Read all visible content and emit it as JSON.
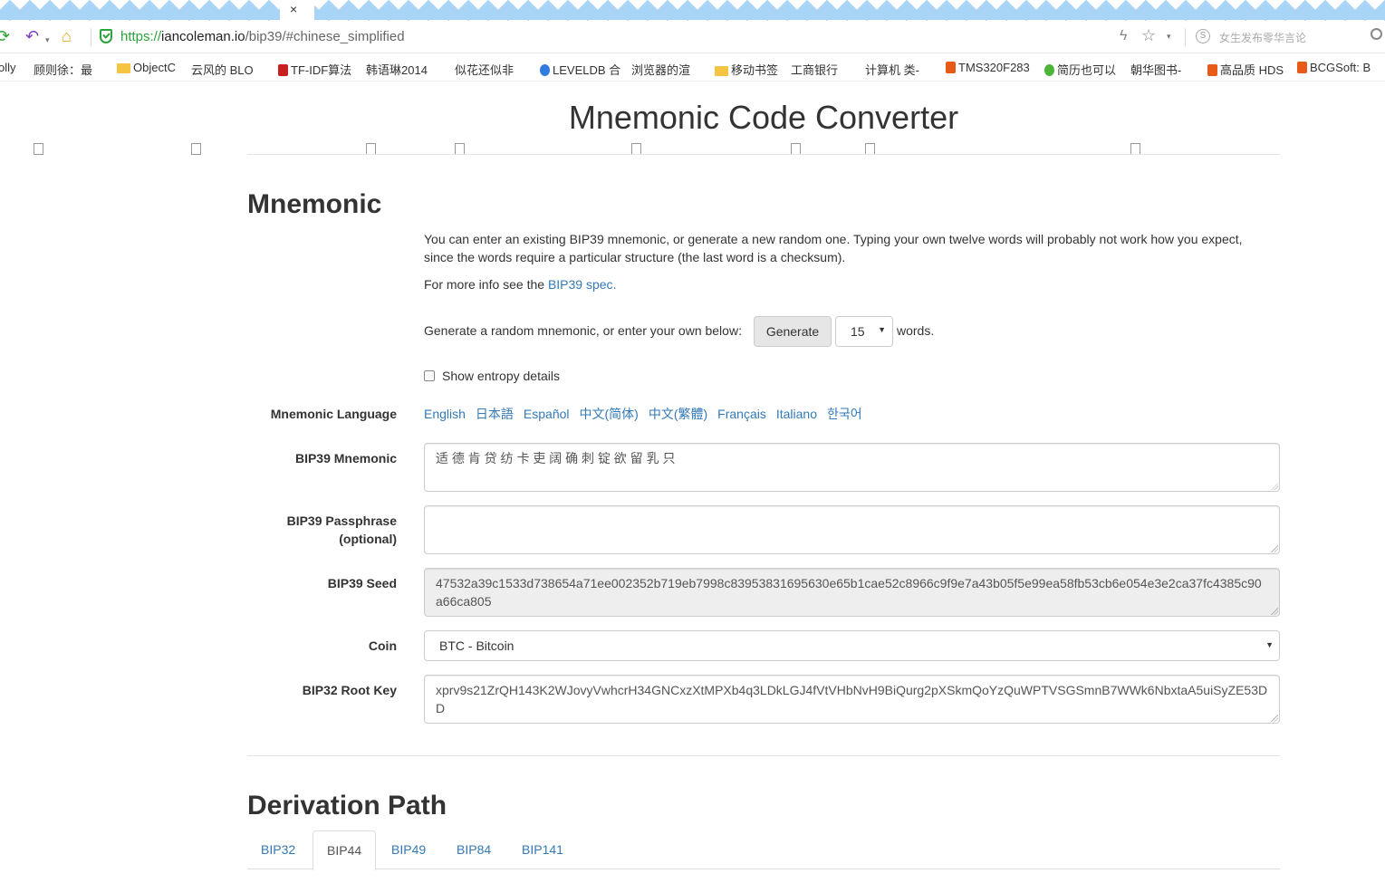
{
  "browser": {
    "tab_close": "×",
    "url": {
      "scheme": "https://",
      "host": "iancoleman.io",
      "path": "/bip39/#chinese_simplified"
    },
    "search_placeholder": "女生发布零华言论",
    "bookmarks": [
      {
        "label": "olly",
        "icon": "none"
      },
      {
        "label": "顾则徐：最",
        "icon": "page"
      },
      {
        "label": "ObjectC",
        "icon": "folder"
      },
      {
        "label": "云风的 BLO",
        "icon": "page"
      },
      {
        "label": "TF-IDF算法",
        "icon": "red"
      },
      {
        "label": "韩语琳2014",
        "icon": "page"
      },
      {
        "label": "似花还似非",
        "icon": "page"
      },
      {
        "label": "LEVELDB 合",
        "icon": "blue"
      },
      {
        "label": "浏览器的渲",
        "icon": "page"
      },
      {
        "label": "移动书签",
        "icon": "folder"
      },
      {
        "label": "工商银行",
        "icon": "page"
      },
      {
        "label": "计算机 类-",
        "icon": "page"
      },
      {
        "label": "TMS320F283",
        "icon": "orange"
      },
      {
        "label": "简历也可以",
        "icon": "green"
      },
      {
        "label": "朝华图书-",
        "icon": "page"
      },
      {
        "label": "高品质 HDS",
        "icon": "orange"
      },
      {
        "label": "BCGSoft: B",
        "icon": "orange"
      }
    ]
  },
  "page": {
    "title": "Mnemonic Code Converter",
    "mnemonic_heading": "Mnemonic",
    "intro": "You can enter an existing BIP39 mnemonic, or generate a new random one. Typing your own twelve words will probably not work how you expect, since the words require a particular structure (the last word is a checksum).",
    "more_info_prefix": "For more info see the ",
    "more_info_link": "BIP39 spec",
    "more_info_suffix": ".",
    "generate_prompt": "Generate a random mnemonic, or enter your own below:",
    "generate_button": "Generate",
    "word_count": "15",
    "words_suffix": "words.",
    "show_entropy": "Show entropy details",
    "language_label": "Mnemonic Language",
    "languages": [
      "English",
      "日本語",
      "Español",
      "中文(简体)",
      "中文(繁體)",
      "Français",
      "Italiano",
      "한국어"
    ],
    "bip39_mnemonic_label": "BIP39 Mnemonic",
    "bip39_mnemonic_value": "适 德 肯 贷 纺 卡 吏 阔 确 刺 锭 欲 留 乳 只",
    "passphrase_label_1": "BIP39 Passphrase",
    "passphrase_label_2": "(optional)",
    "passphrase_value": "",
    "seed_label": "BIP39 Seed",
    "seed_value": "47532a39c1533d738654a71ee002352b719eb7998c83953831695630e65b1cae52c8966c9f9e7a43b05f5e99ea58fb53cb6e054e3e2ca37fc4385c90a66ca805",
    "coin_label": "Coin",
    "coin_value": "BTC - Bitcoin",
    "root_key_label": "BIP32 Root Key",
    "root_key_value": "xprv9s21ZrQH143K2WJovyVwhcrH34GNCxzXtMPXb4q3LDkLGJ4fVtVHbNvH9BiQurg2pXSkmQoYzQuWPTVSGSmnB7WWk6NbxtaA5uiSyZE53DD",
    "derivation_heading": "Derivation Path",
    "derivation_tabs": [
      "BIP32",
      "BIP44",
      "BIP49",
      "BIP84",
      "BIP141"
    ],
    "active_tab": "BIP44"
  },
  "colors": {
    "link": "#337ab7",
    "readonly_bg": "#eeeeee",
    "tabstrip": "#a8d4f5",
    "secure_green": "#2aa43b"
  }
}
